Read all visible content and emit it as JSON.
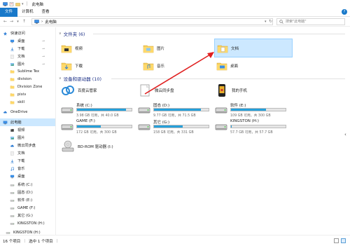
{
  "window": {
    "title": "此电脑"
  },
  "ribbon": {
    "tabs": [
      "文件",
      "计算机",
      "查看"
    ],
    "help": "?"
  },
  "address": {
    "path": "此电脑",
    "separator": "›",
    "search_placeholder": "搜索\"此电脑\""
  },
  "nav": {
    "back": "←",
    "forward": "→",
    "up": "↑"
  },
  "sidebar": {
    "items": [
      {
        "label": "快速访问",
        "icon": "star-icon",
        "pinned": false
      },
      {
        "label": "桌面",
        "icon": "desktop-icon",
        "pinned": true
      },
      {
        "label": "下载",
        "icon": "download-icon",
        "pinned": true
      },
      {
        "label": "文档",
        "icon": "document-icon",
        "pinned": true
      },
      {
        "label": "图片",
        "icon": "picture-icon",
        "pinned": true
      },
      {
        "label": "Sublime Tex",
        "icon": "folder-icon",
        "pinned": false
      },
      {
        "label": "division",
        "icon": "folder-icon",
        "pinned": false
      },
      {
        "label": "Division Zone",
        "icon": "folder-icon",
        "pinned": false
      },
      {
        "label": "pixiv",
        "icon": "folder-icon",
        "pinned": false
      },
      {
        "label": "skill",
        "icon": "folder-icon",
        "pinned": false
      },
      {
        "label": "OneDrive",
        "icon": "cloud-icon",
        "pinned": false
      },
      {
        "label": "此电脑",
        "icon": "computer-icon",
        "pinned": false
      },
      {
        "label": "视频",
        "icon": "video-icon",
        "pinned": false
      },
      {
        "label": "图片",
        "icon": "picture-icon",
        "pinned": false
      },
      {
        "label": "微云同步盘",
        "icon": "cloud-drive-icon",
        "pinned": false
      },
      {
        "label": "文档",
        "icon": "document-icon",
        "pinned": false
      },
      {
        "label": "下载",
        "icon": "download-icon",
        "pinned": false
      },
      {
        "label": "音乐",
        "icon": "music-icon",
        "pinned": false
      },
      {
        "label": "桌面",
        "icon": "desktop-icon",
        "pinned": false
      },
      {
        "label": "系统 (C:)",
        "icon": "drive-icon",
        "pinned": false
      },
      {
        "label": "固态 (D:)",
        "icon": "drive-icon",
        "pinned": false
      },
      {
        "label": "软件 (E:)",
        "icon": "drive-icon",
        "pinned": false
      },
      {
        "label": "GAME (F:)",
        "icon": "drive-icon",
        "pinned": false
      },
      {
        "label": "其它 (G:)",
        "icon": "drive-icon",
        "pinned": false
      },
      {
        "label": "KINGSTON (H:)",
        "icon": "drive-icon",
        "pinned": false
      },
      {
        "label": "KINGSTON (H:)",
        "icon": "usb-drive-icon",
        "pinned": false
      }
    ],
    "pin_glyph": "⊸"
  },
  "folders": {
    "header": "文件夹 (6)",
    "items": [
      {
        "label": "视频",
        "icon": "video-folder-icon"
      },
      {
        "label": "图片",
        "icon": "picture-folder-icon"
      },
      {
        "label": "文档",
        "icon": "document-folder-icon"
      },
      {
        "label": "下载",
        "icon": "download-folder-icon"
      },
      {
        "label": "音乐",
        "icon": "music-folder-icon"
      },
      {
        "label": "桌面",
        "icon": "desktop-folder-icon"
      }
    ]
  },
  "devices": {
    "header": "设备和驱动器 (10)",
    "special": [
      {
        "label": "百度云管家",
        "icon": "baidu-cloud-icon"
      },
      {
        "label": "微云同步盘",
        "icon": "weiyun-icon"
      },
      {
        "label": "我的手机",
        "icon": "phone-icon"
      }
    ],
    "drives": [
      {
        "name": "系统 (C:)",
        "free": "3.98 GB 可用，共 40.0 GB",
        "used_pct": 90
      },
      {
        "name": "固态 (D:)",
        "free": "9.77 GB 可用，共 71.5 GB",
        "used_pct": 86
      },
      {
        "name": "软件 (E:)",
        "free": "109 GB 可用，共 300 GB",
        "used_pct": 64
      },
      {
        "name": "GAME (F:)",
        "free": "172 GB 可用，共 300 GB",
        "used_pct": 43
      },
      {
        "name": "其它 (G:)",
        "free": "158 GB 可用，共 331 GB",
        "used_pct": 52
      },
      {
        "name": "KINGSTON (H:)",
        "free": "57.7 GB 可用，共 57.7 GB",
        "used_pct": 1
      }
    ],
    "optical": {
      "label": "BD-ROM 驱动器 (I:)",
      "icon": "bd-rom-icon"
    }
  },
  "status": {
    "count": "16 个项目",
    "selected": "选中 1 个项目"
  },
  "colors": {
    "accent": "#1979ca",
    "bar_fill": "#26a0da",
    "selection": "#cce8ff",
    "arrow": "#e02020",
    "header": "#1e3287"
  }
}
